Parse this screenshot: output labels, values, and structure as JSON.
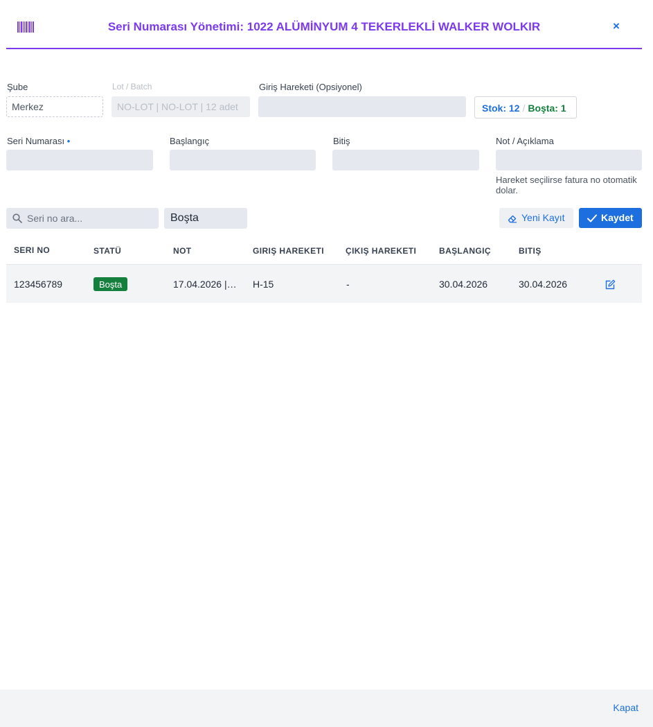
{
  "header": {
    "title": "Seri Numarası Yönetimi: 1022 ALÜMİNYUM 4 TEKERLEKLİ WALKER WOLKIR",
    "icon": "barcode-icon",
    "close_label": "×"
  },
  "form_top": {
    "branch_label": "Şube",
    "branch_value": "Merkez",
    "lot_label": "Lot / Batch",
    "lot_value": "NO-LOT | NO-LOT | 12 adet",
    "entry_label": "Giriş Hareketi (Opsiyonel)",
    "entry_value": "",
    "stock_label": "Stok: 12",
    "stock_separator": "/",
    "idle_label": "Boşta: 1"
  },
  "form_fields": {
    "serial_label": "Seri Numarası",
    "required_mark": "•",
    "start_label": "Başlangıç",
    "end_label": "Bitiş",
    "note_label": "Not / Açıklama",
    "hint": "Hareket seçilirse fatura no otomatik dolar."
  },
  "toolbar": {
    "search_placeholder": "Seri no ara...",
    "status_filter": "Boşta",
    "new_label": "Yeni Kayıt",
    "save_label": "Kaydet"
  },
  "table": {
    "columns": [
      "SERI NO",
      "STATÜ",
      "NOT",
      "GIRIŞ HAREKETI",
      "ÇIKIŞ HAREKETI",
      "BAŞLANGIÇ",
      "BITIŞ"
    ],
    "rows": [
      {
        "serial": "123456789",
        "status": "Boşta",
        "note": "17.04.2026 |…",
        "entry": "H-15",
        "exit": "-",
        "start": "30.04.2026",
        "end": "30.04.2026"
      }
    ]
  },
  "footer": {
    "close_label": "Kapat"
  },
  "colors": {
    "accent": "#7c3aed",
    "primary": "#1d6fe0",
    "success": "#15803d"
  }
}
